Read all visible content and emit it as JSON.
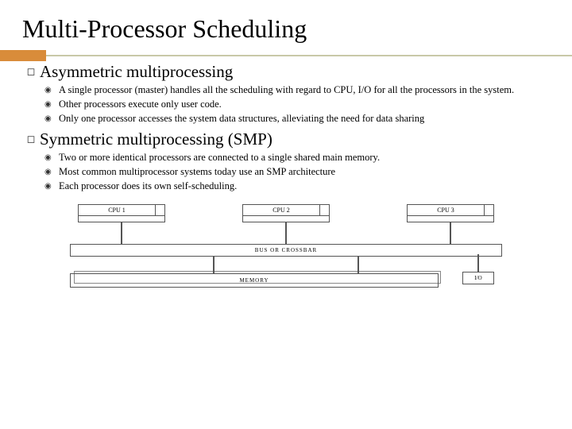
{
  "title": "Multi-Processor Scheduling",
  "sections": [
    {
      "heading": "Asymmetric multiprocessing",
      "items": [
        "A single processor (master) handles all the scheduling with regard to CPU, I/O for all the processors in the system.",
        "Other processors execute only user code.",
        "Only one processor accesses the system data structures, alleviating the need for data sharing"
      ]
    },
    {
      "heading": "Symmetric multiprocessing (SMP)",
      "items": [
        "Two or more identical processors are connected to a single shared main memory.",
        "Most common multiprocessor systems today use an SMP architecture",
        "Each processor does its own self-scheduling."
      ]
    }
  ],
  "diagram": {
    "cpus": [
      "CPU 1",
      "CPU 2",
      "CPU 3"
    ],
    "bus": "BUS OR CROSSBAR",
    "memory": "MEMORY",
    "io": "I/O"
  }
}
